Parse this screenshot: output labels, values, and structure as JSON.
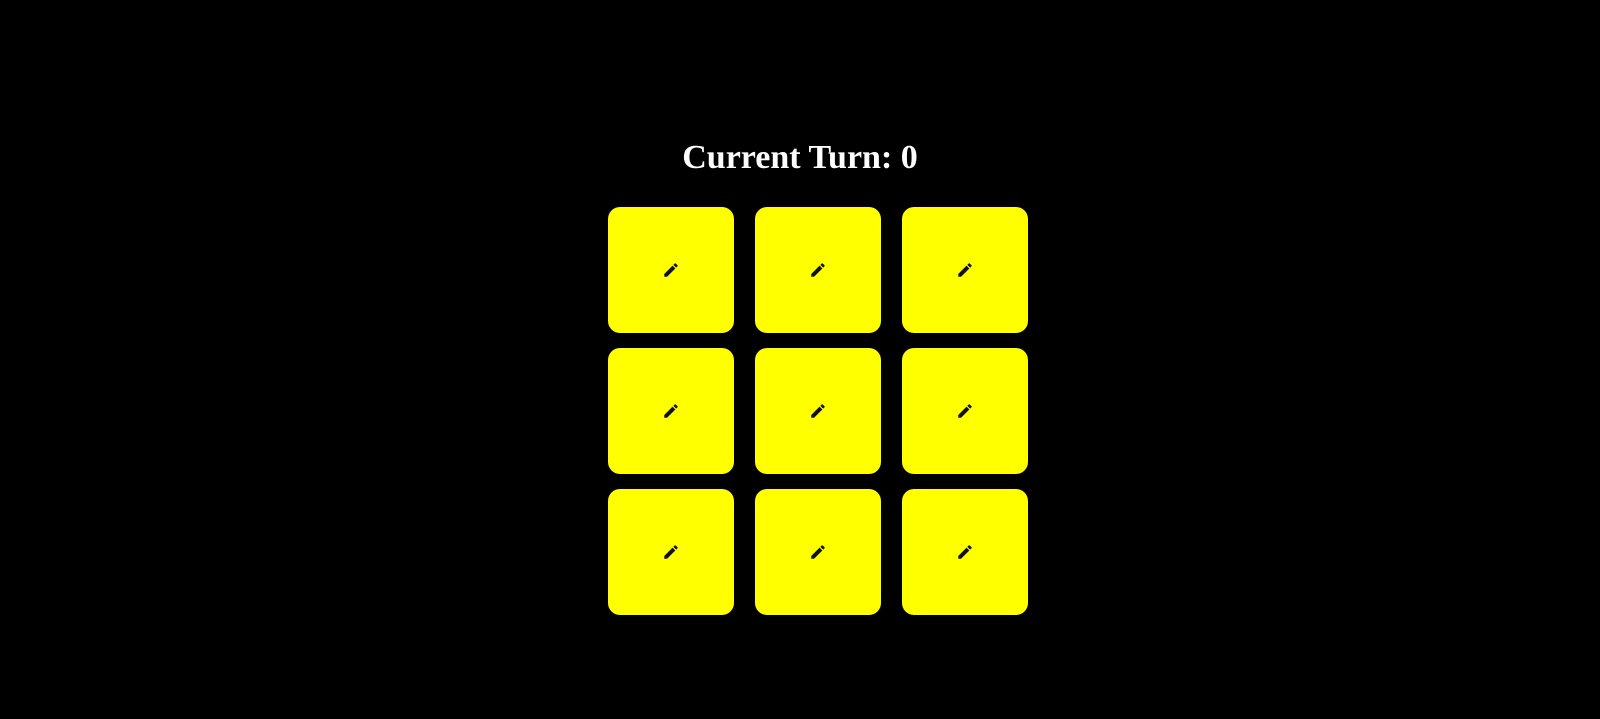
{
  "turn": {
    "label": "Current Turn: 0"
  },
  "board": {
    "cell_color": "#ffff00",
    "cell_icon": "pencil-icon",
    "rows": 3,
    "columns": 3
  }
}
